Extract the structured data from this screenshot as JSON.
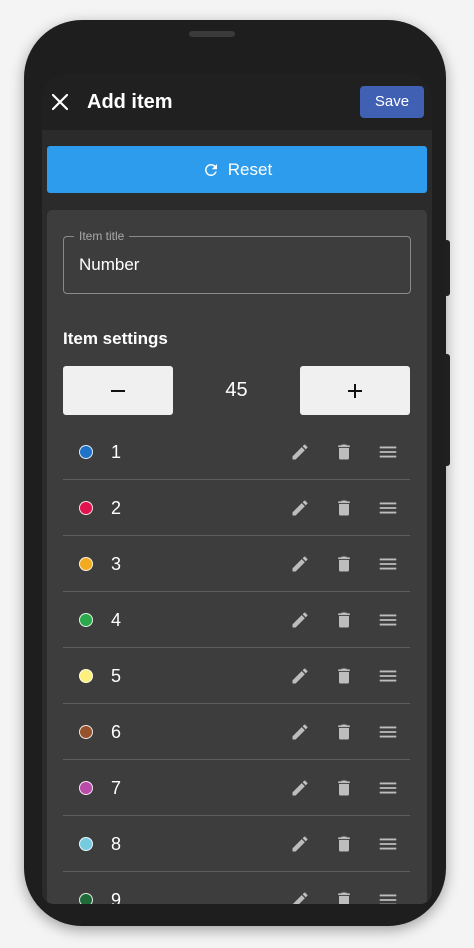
{
  "appbar": {
    "title": "Add item",
    "save_label": "Save",
    "close_icon": "close-icon"
  },
  "reset": {
    "label": "Reset",
    "icon": "refresh-icon"
  },
  "title_field": {
    "legend": "Item title",
    "value": "Number"
  },
  "settings": {
    "heading": "Item settings",
    "stepper": {
      "minus": "−",
      "plus": "+",
      "value": "45"
    }
  },
  "items": [
    {
      "label": "1",
      "color": "#1e73c8"
    },
    {
      "label": "2",
      "color": "#e0134f"
    },
    {
      "label": "3",
      "color": "#f2aa1e"
    },
    {
      "label": "4",
      "color": "#2aaa4a"
    },
    {
      "label": "5",
      "color": "#fcef7c"
    },
    {
      "label": "6",
      "color": "#96522a"
    },
    {
      "label": "7",
      "color": "#b84ca8"
    },
    {
      "label": "8",
      "color": "#76cbe0"
    },
    {
      "label": "9",
      "color": "#1f6b38"
    }
  ],
  "colors": {
    "accent_reset": "#2d9cec",
    "accent_save": "#3f60b3",
    "icon_gray": "#bdbdbd"
  }
}
